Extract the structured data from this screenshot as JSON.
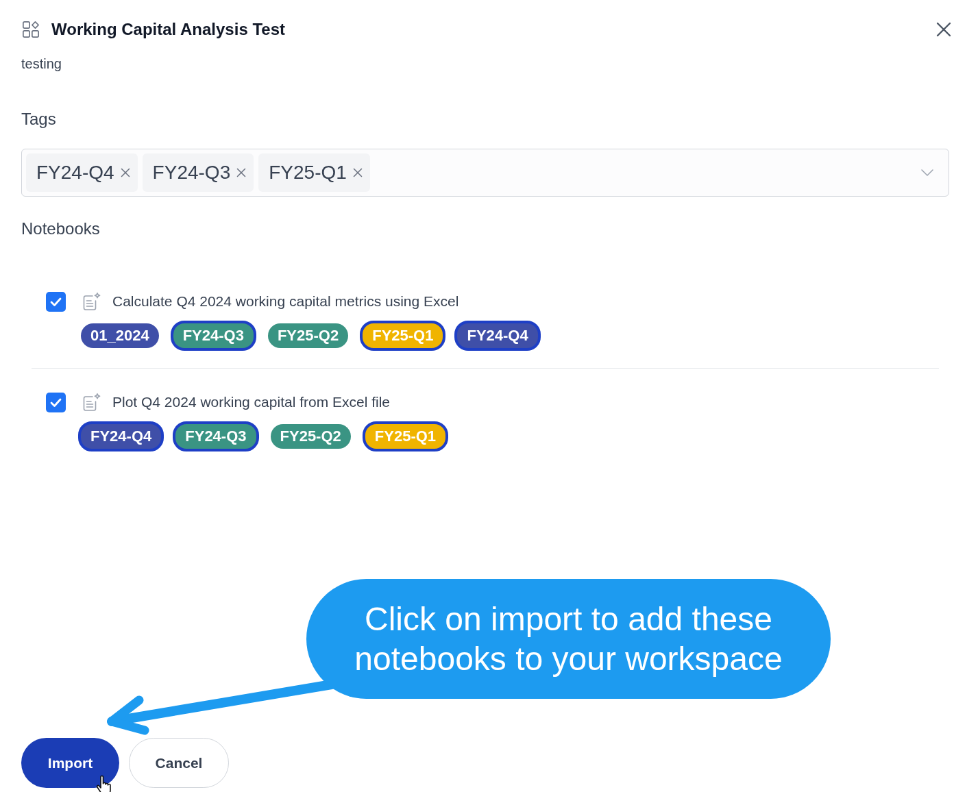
{
  "header": {
    "title": "Working Capital Analysis Test",
    "description": "testing"
  },
  "tags": {
    "label": "Tags",
    "chips": [
      {
        "label": "FY24-Q4"
      },
      {
        "label": "FY24-Q3"
      },
      {
        "label": "FY25-Q1"
      }
    ]
  },
  "notebooks": {
    "label": "Notebooks",
    "items": [
      {
        "title": "Calculate Q4 2024 working capital metrics using Excel",
        "checked": true,
        "tags": [
          {
            "label": "01_2024",
            "color": "#3f4fa8",
            "selected": false
          },
          {
            "label": "FY24-Q3",
            "color": "#3a9483",
            "selected": true
          },
          {
            "label": "FY25-Q2",
            "color": "#3a9483",
            "selected": false
          },
          {
            "label": "FY25-Q1",
            "color": "#f0b400",
            "selected": true
          },
          {
            "label": "FY24-Q4",
            "color": "#3f4fa8",
            "selected": true
          }
        ]
      },
      {
        "title": "Plot Q4 2024 working capital from Excel file",
        "checked": true,
        "tags": [
          {
            "label": "FY24-Q4",
            "color": "#3f4fa8",
            "selected": true
          },
          {
            "label": "FY24-Q3",
            "color": "#3a9483",
            "selected": true
          },
          {
            "label": "FY25-Q2",
            "color": "#3a9483",
            "selected": false
          },
          {
            "label": "FY25-Q1",
            "color": "#f0b400",
            "selected": true
          }
        ]
      }
    ]
  },
  "callout": {
    "text": "Click on import to add these notebooks to your workspace"
  },
  "buttons": [
    {
      "label": "Import",
      "kind": "primary"
    },
    {
      "label": "Cancel",
      "kind": "secondary"
    }
  ]
}
